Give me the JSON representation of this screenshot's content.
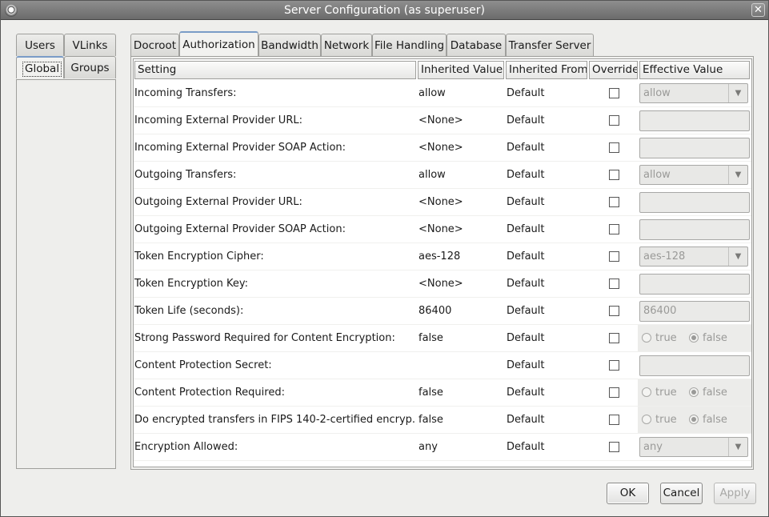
{
  "window": {
    "title": "Server Configuration (as superuser)",
    "close_glyph": "✕"
  },
  "left_tabs": {
    "users": "Users",
    "vlinks": "VLinks",
    "global": "Global",
    "groups": "Groups"
  },
  "tabs": [
    "Docroot",
    "Authorization",
    "Bandwidth",
    "Network",
    "File Handling",
    "Database",
    "Transfer Server"
  ],
  "columns": {
    "setting": "Setting",
    "inherited_value": "Inherited Value",
    "inherited_from": "Inherited From",
    "override": "Override",
    "effective_value": "Effective Value"
  },
  "rows": [
    {
      "setting": "Incoming Transfers:",
      "inherited": "allow",
      "from": "Default",
      "effective": "allow"
    },
    {
      "setting": "Incoming External Provider URL:",
      "inherited": "<None>",
      "from": "Default",
      "effective": ""
    },
    {
      "setting": "Incoming External Provider SOAP Action:",
      "inherited": "<None>",
      "from": "Default",
      "effective": ""
    },
    {
      "setting": "Outgoing Transfers:",
      "inherited": "allow",
      "from": "Default",
      "effective": "allow"
    },
    {
      "setting": "Outgoing External Provider URL:",
      "inherited": "<None>",
      "from": "Default",
      "effective": ""
    },
    {
      "setting": "Outgoing External Provider SOAP Action:",
      "inherited": "<None>",
      "from": "Default",
      "effective": ""
    },
    {
      "setting": "Token Encryption Cipher:",
      "inherited": "aes-128",
      "from": "Default",
      "effective": "aes-128"
    },
    {
      "setting": "Token Encryption Key:",
      "inherited": "<None>",
      "from": "Default",
      "effective": ""
    },
    {
      "setting": "Token Life (seconds):",
      "inherited": "86400",
      "from": "Default",
      "effective": "86400"
    },
    {
      "setting": "Strong Password Required for Content Encryption:",
      "inherited": "false",
      "from": "Default",
      "effective_true": "true",
      "effective_false": "false"
    },
    {
      "setting": "Content Protection Secret:",
      "inherited": "",
      "from": "Default",
      "effective": ""
    },
    {
      "setting": "Content Protection Required:",
      "inherited": "false",
      "from": "Default",
      "effective_true": "true",
      "effective_false": "false"
    },
    {
      "setting": "Do encrypted transfers in FIPS 140-2-certified encryp...",
      "inherited": "false",
      "from": "Default",
      "effective_true": "true",
      "effective_false": "false"
    },
    {
      "setting": "Encryption Allowed:",
      "inherited": "any",
      "from": "Default",
      "effective": "any"
    }
  ],
  "buttons": {
    "ok": "OK",
    "cancel": "Cancel",
    "apply": "Apply"
  },
  "colors": {
    "titlebar": "#7d7d7d",
    "active_tab_accent": "#7a9cc7",
    "disabled_text": "#9a9a98"
  }
}
